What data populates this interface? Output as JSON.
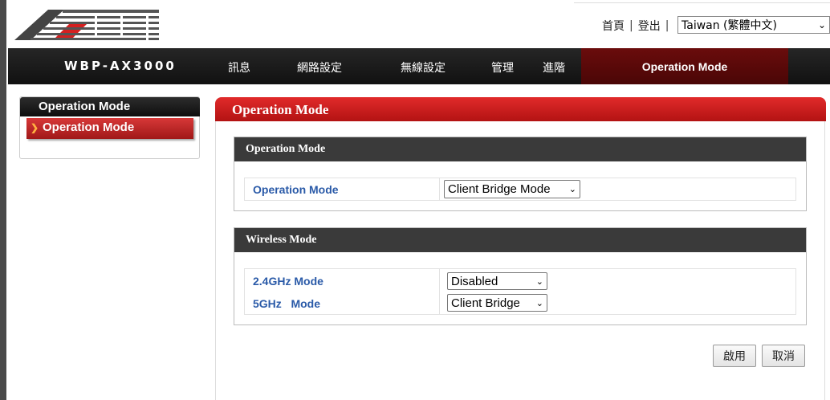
{
  "header": {
    "logo_text": "ABST",
    "links": [
      "首頁",
      "登出"
    ],
    "separator": "|",
    "language": {
      "selected": "Taiwan (繁體中文)"
    }
  },
  "navbar": {
    "model": "WBP-AX3000",
    "items": [
      "訊息",
      "網路設定",
      "無線設定",
      "管理",
      "進階"
    ],
    "active": "Operation Mode"
  },
  "side_menu": {
    "title": "Operation Mode",
    "items": [
      "Operation Mode"
    ]
  },
  "main": {
    "title": "Operation Mode",
    "sections": [
      {
        "heading": "Operation Mode",
        "rows": [
          {
            "label": "Operation Mode",
            "value": "Client Bridge Mode"
          }
        ]
      },
      {
        "heading": "Wireless Mode",
        "rows": [
          {
            "label": "2.4GHz Mode",
            "value": "Disabled"
          },
          {
            "label": "5GHz   Mode",
            "value": "Client Bridge"
          }
        ]
      }
    ],
    "buttons": {
      "apply": "啟用",
      "cancel": "取消"
    }
  },
  "colors": {
    "nav_bg": "#1a1a1a",
    "nav_active": "#5a0909",
    "accent_red": "#c81e1e",
    "label_blue": "#2a5aa8",
    "section_head": "#3a3a3a"
  },
  "icons": {
    "dropdown": "chevron-down-icon",
    "menu_arrow": "chevron-right-icon"
  }
}
